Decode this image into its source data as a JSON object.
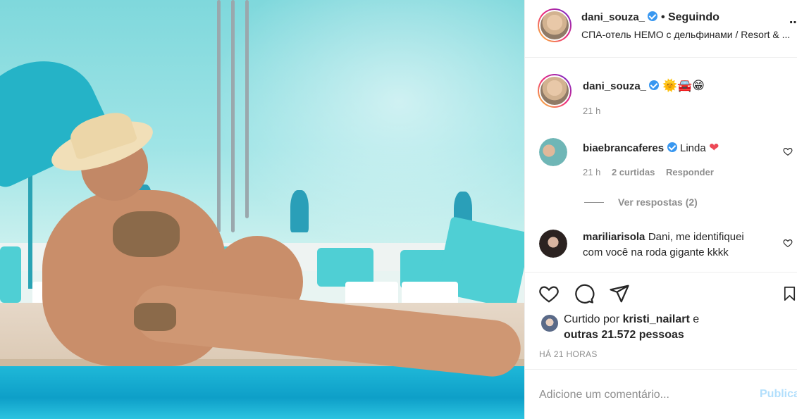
{
  "post": {
    "author": "dani_souza_",
    "follow_status": "• Seguindo",
    "location": "СПА-отель HEMO с дельфинами / Resort & ...",
    "more_icon": "more-horizontal-icon"
  },
  "caption": {
    "username": "dani_souza_",
    "text": "🌞🚘😁",
    "time": "21 h"
  },
  "comments": [
    {
      "username": "biaebrancaferes",
      "text": "Linda",
      "emoji": "❤",
      "time": "21 h",
      "likes": "2 curtidas",
      "reply": "Responder",
      "view_replies": "Ver respostas (2)"
    },
    {
      "username": "mariliarisola",
      "text_line1": "Dani, me identifiquei",
      "text_line2": "com você na roda gigante kkkk"
    }
  ],
  "likes": {
    "prefix": "Curtido por",
    "user": "kristi_nailart",
    "connector": "e",
    "others": "outras 21.572 pessoas"
  },
  "timestamp": "HÁ 21 HORAS",
  "add_comment": {
    "placeholder": "Adicione um comentário...",
    "publish": "Publicar"
  },
  "colors": {
    "verified": "#3897f0",
    "heart_red": "#ed4956",
    "publish_disabled": "#b2dffc"
  }
}
